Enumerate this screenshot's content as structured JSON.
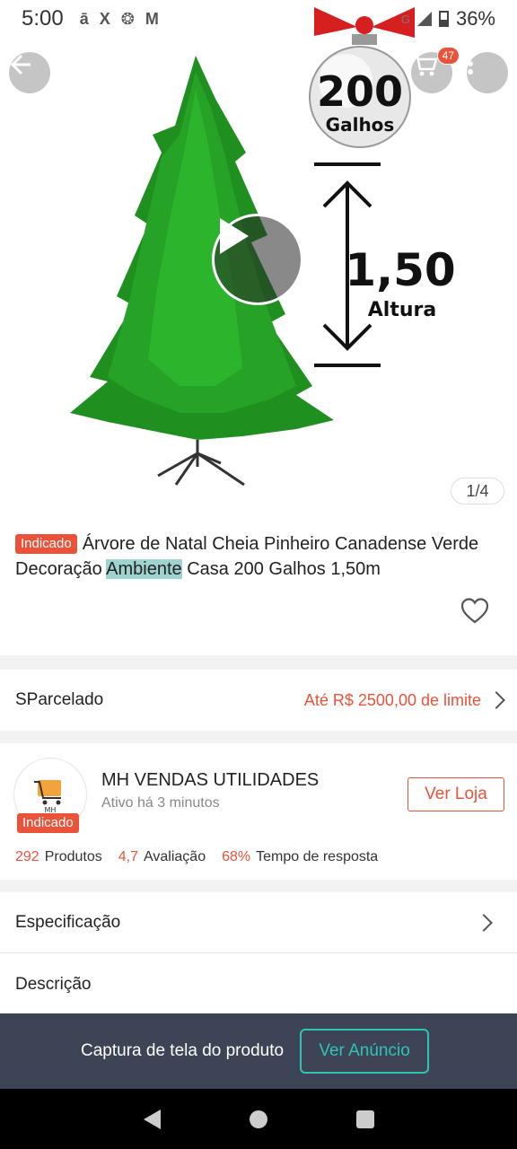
{
  "status_bar": {
    "time": "5:00",
    "left_icons": [
      "ā",
      "X",
      "❂",
      "M"
    ],
    "battery": "36%",
    "network": "G"
  },
  "hero": {
    "cart_count": "47",
    "page_indicator": "1/4",
    "ornament_number": "200",
    "ornament_label": "Galhos",
    "height_value": "1,50",
    "height_label": "Altura"
  },
  "product": {
    "badge": "Indicado",
    "title_part1": "Árvore de Natal Cheia Pinheiro Canadense Verde Decoração ",
    "title_highlight": "Ambiente",
    "title_part2": " Casa 200  Galhos 1,50m"
  },
  "parcelado": {
    "label": "SParcelado",
    "limit": "Até R$ 2500,00 de limite"
  },
  "store": {
    "name": "MH VENDAS UTILIDADES",
    "active": "Ativo há 3 minutos",
    "badge": "Indicado",
    "logo_text": "MH",
    "visit_button": "Ver Loja",
    "stats": [
      {
        "value": "292",
        "label": "Produtos"
      },
      {
        "value": "4,7",
        "label": "Avaliação"
      },
      {
        "value": "68%",
        "label": "Tempo de resposta"
      }
    ]
  },
  "sections": {
    "spec": "Especificação",
    "desc": "Descrição"
  },
  "capture_bar": {
    "label": "Captura de tela do produto",
    "button": "Ver Anúncio"
  },
  "colors": {
    "accent": "#e8533a",
    "teal": "#2ec4b6",
    "dark_bar": "#3d4456"
  }
}
